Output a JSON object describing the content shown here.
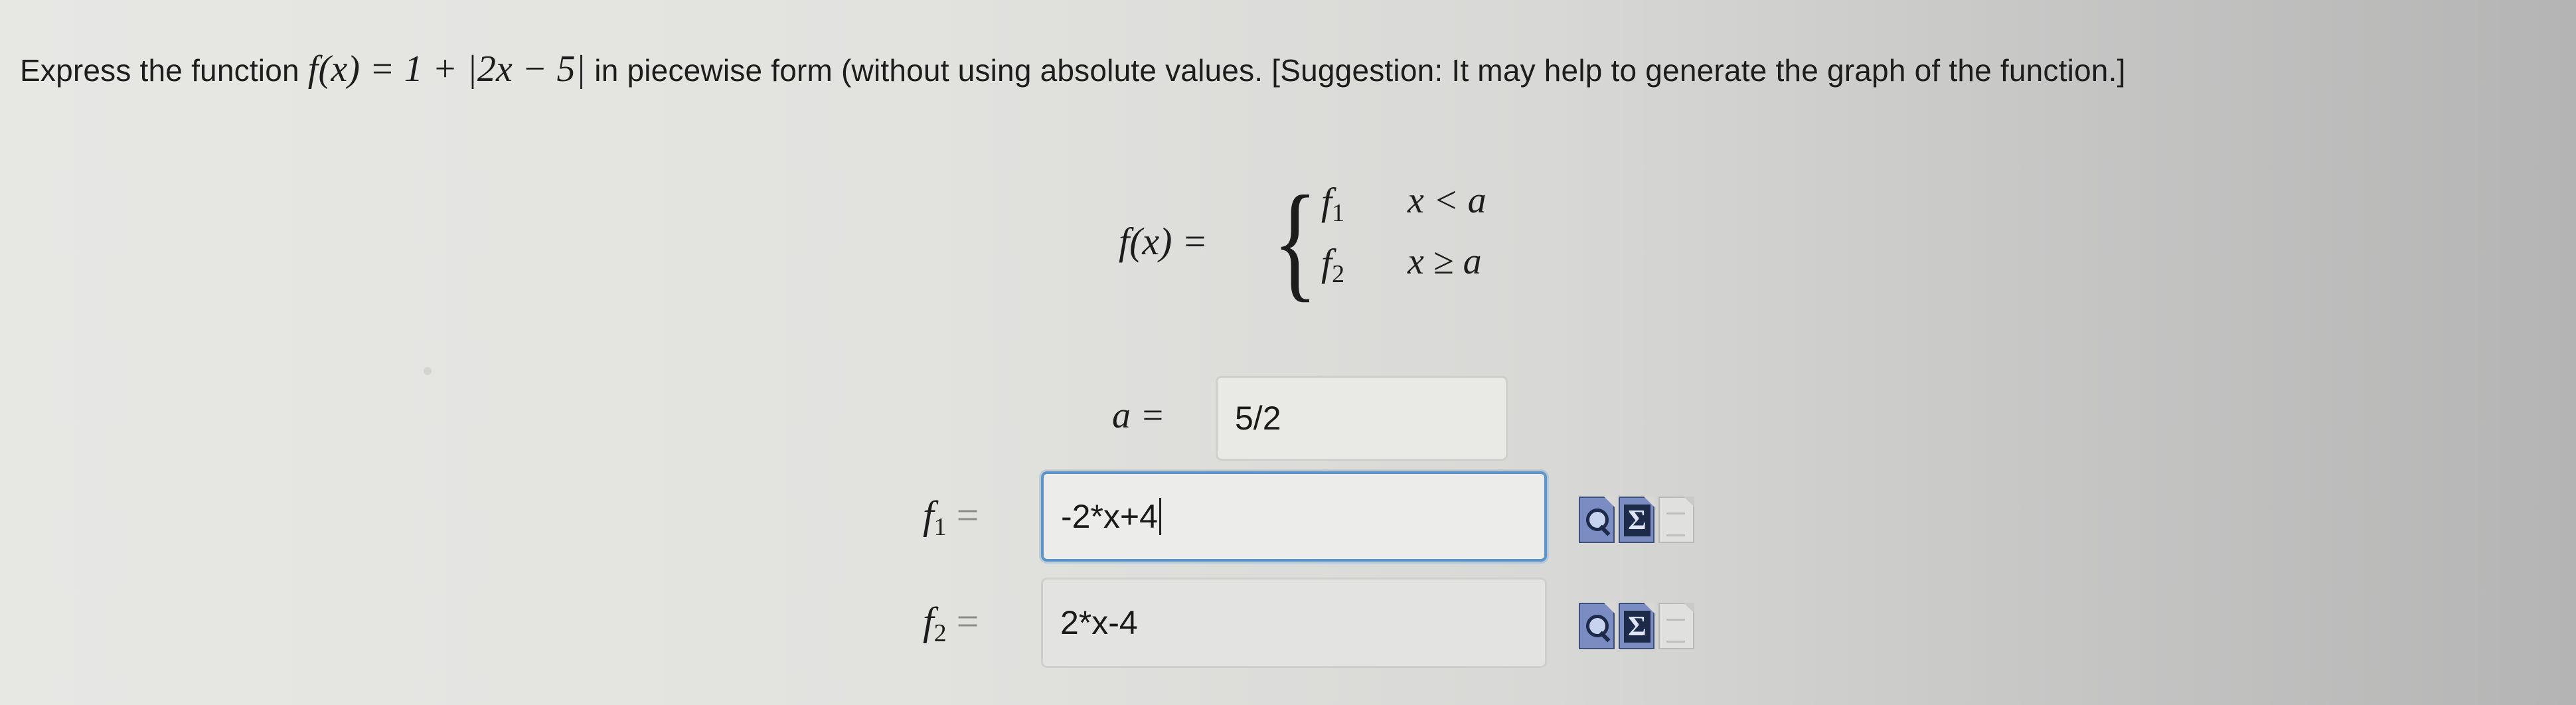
{
  "question": {
    "prefix": "Express the function ",
    "function_text": "f(x) = 1 + |2x − 5|",
    "suffix": " in piecewise form (without using absolute values. [Suggestion: It may help to generate the graph of the function.]"
  },
  "piecewise": {
    "lhs": "f(x) =",
    "row1_func": "f",
    "row1_sub": "1",
    "row1_cond": "x < a",
    "row2_func": "f",
    "row2_sub": "2",
    "row2_cond": "x ≥ a"
  },
  "a_field": {
    "label": "a =",
    "value": "5/2"
  },
  "f1_field": {
    "label": "f",
    "sub": "1",
    "eq": "=",
    "value": "-2*x+4"
  },
  "f2_field": {
    "label": "f",
    "sub": "2",
    "eq": "=",
    "value": "2*x-4"
  },
  "tools": {
    "sigma": "Σ"
  }
}
